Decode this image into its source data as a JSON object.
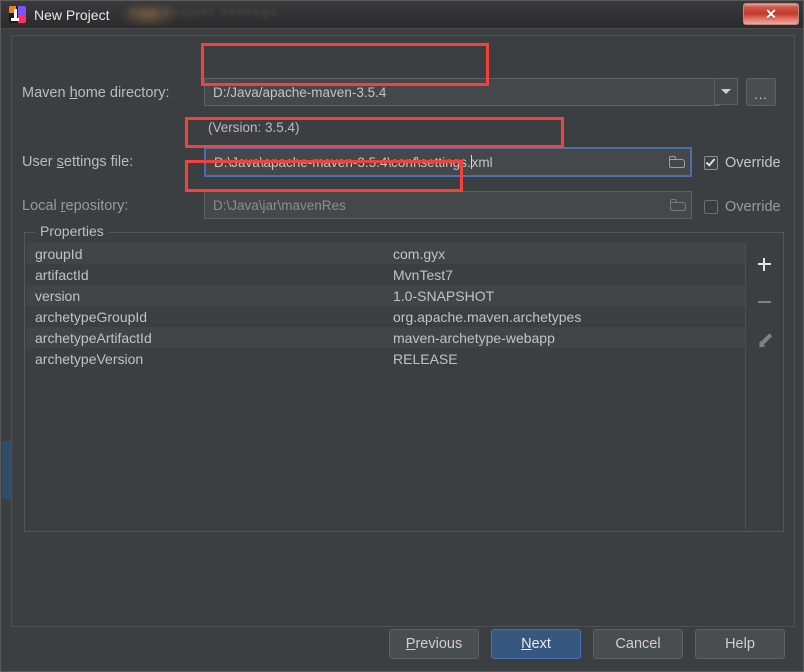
{
  "window": {
    "title": "New Project",
    "app_icon": "intellij-idea-icon",
    "close_label": "✕"
  },
  "form": {
    "maven_home": {
      "label_pre": "Maven ",
      "label_mnemonic": "h",
      "label_post": "ome directory:",
      "value": "D:/Java/apache-maven-3.5.4",
      "dropdown_icon": "chevron-down-icon",
      "browse_label": "..."
    },
    "version_note": "(Version: 3.5.4)",
    "user_settings": {
      "label_pre": "User ",
      "label_mnemonic": "s",
      "label_post": "ettings file:",
      "value": "D:\\Java\\apache-maven-3.5.4\\conf\\settings.",
      "value_tail": "xml",
      "browse_icon": "folder-icon",
      "override_label": "Override",
      "override_checked": true
    },
    "local_repository": {
      "label_pre": "Local ",
      "label_mnemonic": "r",
      "label_post": "epository:",
      "value": "D:\\Java\\jar\\mavenRes",
      "browse_icon": "folder-icon",
      "override_label": "Override",
      "override_checked": false
    }
  },
  "properties": {
    "title": "Properties",
    "rows": [
      {
        "name": "groupId",
        "value": "com.gyx"
      },
      {
        "name": "artifactId",
        "value": "MvnTest7"
      },
      {
        "name": "version",
        "value": "1.0-SNAPSHOT"
      },
      {
        "name": "archetypeGroupId",
        "value": "org.apache.maven.archetypes"
      },
      {
        "name": "archetypeArtifactId",
        "value": "maven-archetype-webapp"
      },
      {
        "name": "archetypeVersion",
        "value": "RELEASE"
      }
    ],
    "toolbar": {
      "add_icon": "plus-icon",
      "remove_icon": "minus-icon",
      "edit_icon": "pencil-icon"
    }
  },
  "buttons": {
    "previous": {
      "pre": "",
      "mnemonic": "P",
      "post": "revious"
    },
    "next": {
      "pre": "",
      "mnemonic": "N",
      "post": "ext"
    },
    "cancel": {
      "pre": "Cancel",
      "mnemonic": "",
      "post": ""
    },
    "help": {
      "pre": "Help",
      "mnemonic": "",
      "post": ""
    }
  },
  "colors": {
    "dialog_bg": "#3c3f41",
    "field_bg": "#45484a",
    "focus_border": "#4b6eaf",
    "primary_button": "#365880",
    "annotation": "#f4413c",
    "close_button": "#c0392b"
  }
}
